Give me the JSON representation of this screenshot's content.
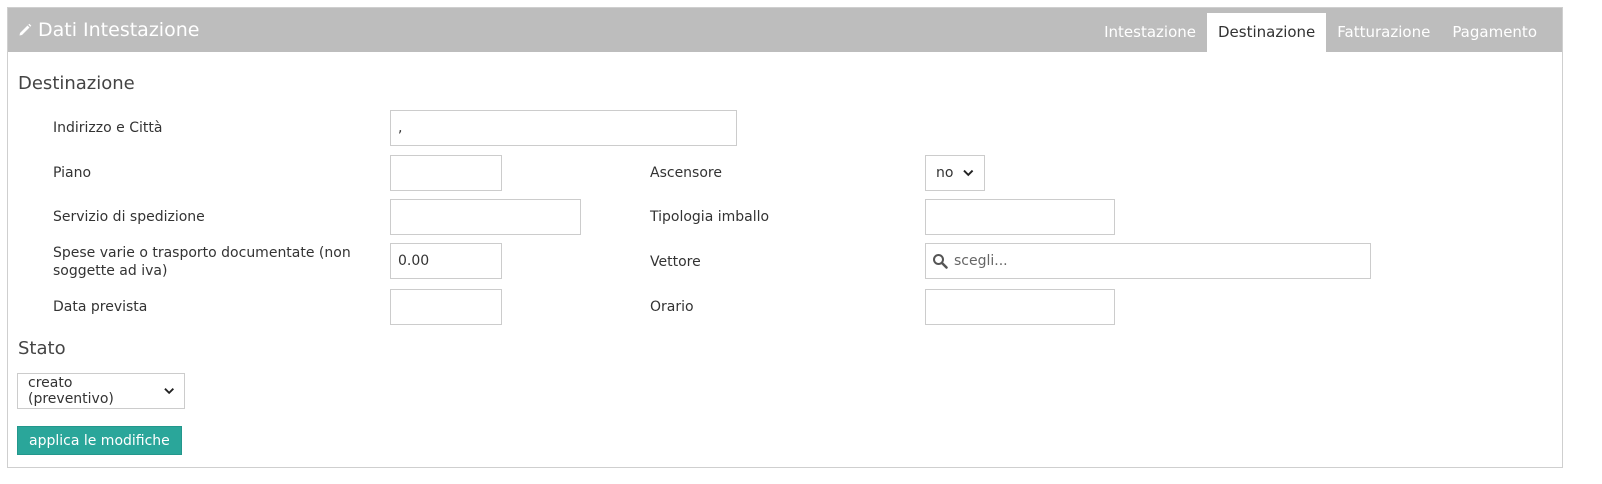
{
  "header": {
    "title": "Dati Intestazione",
    "tabs": [
      {
        "label": "Intestazione"
      },
      {
        "label": "Destinazione"
      },
      {
        "label": "Fatturazione"
      },
      {
        "label": "Pagamento"
      }
    ],
    "active_tab": "Destinazione"
  },
  "destinazione": {
    "section_title": "Destinazione",
    "indirizzo": {
      "label": "Indirizzo e Città",
      "value": ","
    },
    "piano": {
      "label": "Piano",
      "value": ""
    },
    "ascensore": {
      "label": "Ascensore",
      "value": "no"
    },
    "servizio": {
      "label": "Servizio di spedizione",
      "value": ""
    },
    "tipologia": {
      "label": "Tipologia imballo",
      "value": ""
    },
    "spese": {
      "label": "Spese varie o trasporto documentate (non soggette ad iva)",
      "value": "0.00"
    },
    "vettore": {
      "label": "Vettore",
      "placeholder": "scegli..."
    },
    "data_prevista": {
      "label": "Data prevista",
      "value": ""
    },
    "orario": {
      "label": "Orario",
      "value": ""
    }
  },
  "stato": {
    "section_title": "Stato",
    "value": "creato (preventivo)"
  },
  "actions": {
    "apply_label": "applica le modifiche"
  },
  "colors": {
    "header_bg": "#bdbdbd",
    "accent": "#2aa69a"
  }
}
